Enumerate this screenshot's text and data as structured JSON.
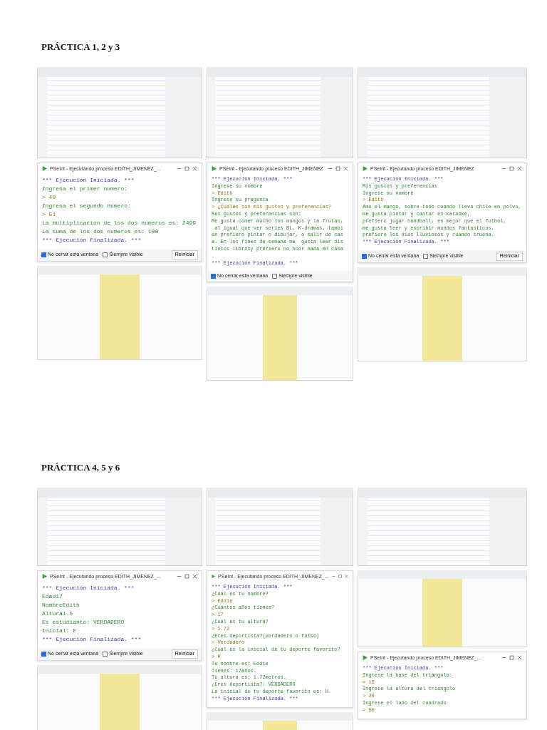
{
  "sections": [
    {
      "heading": "PRÁCTICA 1, 2 y 3",
      "columns": [
        [
          {
            "kind": "editor"
          },
          {
            "kind": "console",
            "title": "PSeInt - Ejecutando proceso EDITH_JIMENEZ_...",
            "lines": [
              {
                "kind": "system",
                "text": "*** Ejecución Iniciada. ***"
              },
              {
                "kind": "prompt",
                "text": "Ingresa el primer numero:"
              },
              {
                "kind": "input",
                "text": "> 49"
              },
              {
                "kind": "prompt",
                "text": "Ingresa el segundo numero:"
              },
              {
                "kind": "input",
                "text": "> 51"
              },
              {
                "kind": "prompt",
                "text": "La multiplicacion de los dos numeros es: 2499"
              },
              {
                "kind": "prompt",
                "text": "La suma de los dos numeros es: 100"
              },
              {
                "kind": "system",
                "text": "*** Ejecución Finalizada. ***"
              }
            ],
            "options": [
              {
                "label": "No cerrar esta ventana",
                "checked": true
              },
              {
                "label": "Siempre visible",
                "checked": false
              }
            ],
            "button": "Reiniciar"
          },
          {
            "kind": "flowchart"
          }
        ],
        [
          {
            "kind": "editor"
          },
          {
            "kind": "console",
            "title": "PSeInt - Ejecutando proceso EDITH_JIMENEZ",
            "lines": [
              {
                "kind": "system",
                "text": "*** Ejecución Iniciada. ***"
              },
              {
                "kind": "prompt",
                "text": "Ingrese su nombre"
              },
              {
                "kind": "input",
                "text": "> Edith"
              },
              {
                "kind": "prompt",
                "text": "Ingrese su pregunta"
              },
              {
                "kind": "input",
                "text": "> ¿Cuales son mis gustos y preferencias?"
              },
              {
                "kind": "prompt",
                "text": "Sus gustos y preferencias son:"
              },
              {
                "kind": "prompt",
                "text": "Me gusta comer mucho los mangos y la frutas,"
              },
              {
                "kind": "prompt",
                "text": " al igual que ver series BL, K-dramas, tambi"
              },
              {
                "kind": "prompt",
                "text": "en prefiero pintar o dibujar, o salir de cas"
              },
              {
                "kind": "prompt",
                "text": "a. En los fines de semana me  gusta leer dis"
              },
              {
                "kind": "prompt",
                "text": "tintos librosy prefiero no hcer nada en casa"
              },
              {
                "kind": "prompt",
                "text": "."
              },
              {
                "kind": "system",
                "text": "*** Ejecución Finalizada. ***"
              }
            ],
            "options": [
              {
                "label": "No cerrar esta ventana",
                "checked": true
              },
              {
                "label": "Siempre visible",
                "checked": false
              }
            ]
          },
          {
            "kind": "flowchart"
          }
        ],
        [
          {
            "kind": "editor"
          },
          {
            "kind": "console",
            "title": "PSeInt - Ejecutando proceso EDITH_JIMENEZ",
            "lines": [
              {
                "kind": "system",
                "text": "*** Ejecución Iniciada. ***"
              },
              {
                "kind": "prompt",
                "text": "Mis gustos y preferencias"
              },
              {
                "kind": "prompt",
                "text": "Ingrese su nombre"
              },
              {
                "kind": "input",
                "text": "> Edith"
              },
              {
                "kind": "prompt",
                "text": "Amo el mango, sobre todo cuando lleva chile en polvo,"
              },
              {
                "kind": "prompt",
                "text": "me gusta pintar y cantar en karaoke,"
              },
              {
                "kind": "prompt",
                "text": "prefiero jugar handball, es mejor que el futbol,"
              },
              {
                "kind": "prompt",
                "text": "me gusta leer y escribir mundos fantasticos,"
              },
              {
                "kind": "prompt",
                "text": "prefiero los dias lluviosos y cuando truena."
              },
              {
                "kind": "system",
                "text": "*** Ejecución Finalizada. ***"
              }
            ],
            "options": [
              {
                "label": "No cerrar esta ventana",
                "checked": true
              },
              {
                "label": "Siempre visible",
                "checked": false
              }
            ],
            "button": "Reiniciar"
          },
          {
            "kind": "flowchart"
          }
        ]
      ]
    },
    {
      "heading": "PRÁCTICA 4, 5 y 6",
      "columns": [
        [
          {
            "kind": "editor"
          },
          {
            "kind": "console",
            "title": "PSeInt - Ejecutando proceso EDITH_JIMENEZ_...",
            "lines": [
              {
                "kind": "system",
                "text": "*** Ejecución Iniciada. ***"
              },
              {
                "kind": "prompt",
                "text": "Edad17"
              },
              {
                "kind": "prompt",
                "text": "NombreEdith"
              },
              {
                "kind": "prompt",
                "text": "Altura1.5"
              },
              {
                "kind": "prompt",
                "text": "Es estudiante: VERDADERO"
              },
              {
                "kind": "prompt",
                "text": "Inicial: E"
              },
              {
                "kind": "system",
                "text": "*** Ejecución Finalizada. ***"
              }
            ],
            "options": [
              {
                "label": "No cerrar esta ventana",
                "checked": true
              },
              {
                "label": "Siempre visible",
                "checked": false
              }
            ],
            "button": "Reiniciar"
          },
          {
            "kind": "flowchart"
          }
        ],
        [
          {
            "kind": "editor"
          },
          {
            "kind": "console",
            "title": "PSeInt - Ejecutando proceso EDITH_JIMENEZ_...",
            "lines": [
              {
                "kind": "system",
                "text": "*** Ejecución Iniciada. ***"
              },
              {
                "kind": "prompt",
                "text": "¿Cuál es tu nombre?"
              },
              {
                "kind": "input",
                "text": "> Eddie"
              },
              {
                "kind": "prompt",
                "text": "¿Cuántos años tienes?"
              },
              {
                "kind": "input",
                "text": "> 17"
              },
              {
                "kind": "prompt",
                "text": "¿Cuál es tu altura?"
              },
              {
                "kind": "input",
                "text": "> 1.72"
              },
              {
                "kind": "prompt",
                "text": "¿Eres deportista?(verdadero o falso)"
              },
              {
                "kind": "input",
                "text": "> Verdadero"
              },
              {
                "kind": "prompt",
                "text": "¿Cuál es la inicial de tu deporte favorito?"
              },
              {
                "kind": "input",
                "text": "> H"
              },
              {
                "kind": "prompt",
                "text": "Tu nombre es: Eddie"
              },
              {
                "kind": "prompt",
                "text": "Tienes: 17años."
              },
              {
                "kind": "prompt",
                "text": "Tu altura es: 1.72metros."
              },
              {
                "kind": "prompt",
                "text": "¿Eres deportista?: VERDADERO"
              },
              {
                "kind": "prompt",
                "text": "La inicial de tu deporte favorito es: H"
              },
              {
                "kind": "system",
                "text": "*** Ejecución Finalizada. ***"
              }
            ]
          },
          {
            "kind": "flowchart"
          }
        ],
        [
          {
            "kind": "editor"
          },
          {
            "kind": "flowchart"
          },
          {
            "kind": "console",
            "title": "PSeInt - Ejecutando proceso EDITH_JIMENEZ_...",
            "lines": [
              {
                "kind": "system",
                "text": "*** Ejecución Iniciada. ***"
              },
              {
                "kind": "prompt",
                "text": "Ingrese la base del triángulo:"
              },
              {
                "kind": "input",
                "text": "> 15"
              },
              {
                "kind": "prompt",
                "text": "Ingrese la altura del triangulo"
              },
              {
                "kind": "input",
                "text": "> 20"
              },
              {
                "kind": "prompt",
                "text": "Ingrese el lado del cuadrado"
              },
              {
                "kind": "input",
                "text": "> 50"
              }
            ]
          }
        ]
      ]
    }
  ]
}
